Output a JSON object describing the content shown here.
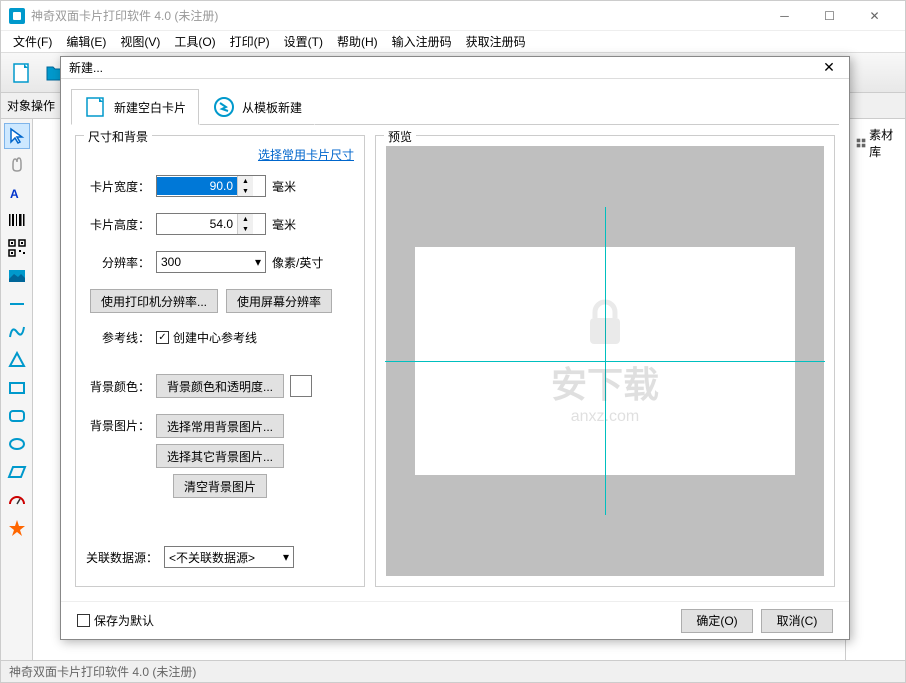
{
  "app": {
    "title": "神奇双面卡片打印软件 4.0 (未注册)",
    "status": "神奇双面卡片打印软件 4.0 (未注册)"
  },
  "menu": {
    "file": "文件(F)",
    "edit": "编辑(E)",
    "view": "视图(V)",
    "tools": "工具(O)",
    "print": "打印(P)",
    "settings": "设置(T)",
    "help": "帮助(H)",
    "regcode": "输入注册码",
    "getreg": "获取注册码"
  },
  "leftbar": {
    "label": "对象操作"
  },
  "rightpanel": {
    "library": "素材库"
  },
  "dialog": {
    "title": "新建...",
    "tab_blank": "新建空白卡片",
    "tab_template": "从模板新建",
    "group_size": "尺寸和背景",
    "group_preview": "预览",
    "link_common_size": "选择常用卡片尺寸",
    "width_label": "卡片宽度：",
    "width_value": "90.0",
    "height_label": "卡片高度：",
    "height_value": "54.0",
    "unit_mm": "毫米",
    "dpi_label": "分辨率：",
    "dpi_value": "300",
    "dpi_unit": "像素/英寸",
    "btn_printer_dpi": "使用打印机分辨率...",
    "btn_screen_dpi": "使用屏幕分辨率",
    "guides_label": "参考线：",
    "guides_check": "创建中心参考线",
    "bgcolor_label": "背景颜色：",
    "bgcolor_btn": "背景颜色和透明度...",
    "bgimg_label": "背景图片：",
    "bgimg_common": "选择常用背景图片...",
    "bgimg_other": "选择其它背景图片...",
    "bgimg_clear": "清空背景图片",
    "datasource_label": "关联数据源：",
    "datasource_value": "<不关联数据源>",
    "save_default": "保存为默认",
    "ok": "确定(O)",
    "cancel": "取消(C)"
  },
  "watermark": {
    "main": "安下载",
    "sub": "anxz.com"
  }
}
